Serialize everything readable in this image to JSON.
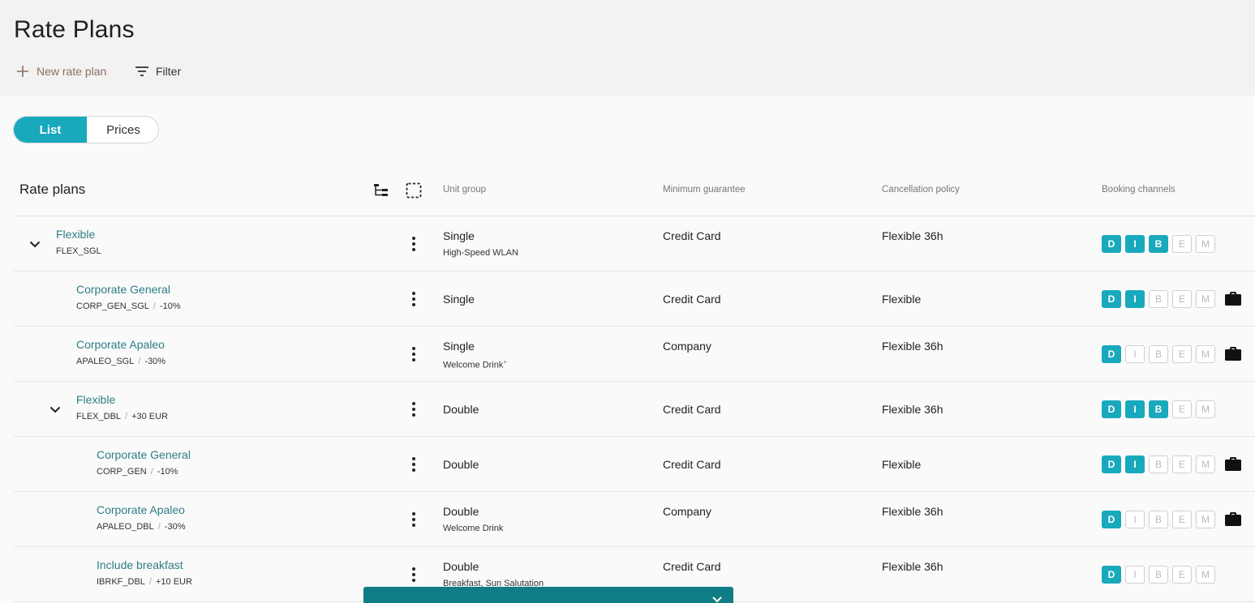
{
  "page": {
    "title": "Rate Plans"
  },
  "actions": {
    "new_label": "New rate plan",
    "filter_label": "Filter"
  },
  "view_toggle": {
    "list": "List",
    "prices": "Prices",
    "selected": "List"
  },
  "table": {
    "title": "Rate plans",
    "columns": {
      "unit_group": "Unit group",
      "minimum_guarantee": "Minimum guarantee",
      "cancellation_policy": "Cancellation policy",
      "booking_channels": "Booking channels"
    },
    "channel_letters": [
      "D",
      "I",
      "B",
      "E",
      "M"
    ],
    "rows": [
      {
        "name": "Flexible",
        "code": "FLEX_SGL",
        "modifier": "",
        "level": 0,
        "expandable": true,
        "unit_group": "Single",
        "unit_extra": "High-Speed WLAN",
        "unit_extra_sup": "",
        "guarantee": "Credit Card",
        "cancellation": "Flexible 36h",
        "channels": [
          true,
          true,
          true,
          false,
          false
        ],
        "corporate": false
      },
      {
        "name": "Corporate General",
        "code": "CORP_GEN_SGL",
        "modifier": "-10%",
        "level": 1,
        "expandable": false,
        "unit_group": "Single",
        "unit_extra": "",
        "unit_extra_sup": "",
        "guarantee": "Credit Card",
        "cancellation": "Flexible",
        "channels": [
          true,
          true,
          false,
          false,
          false
        ],
        "corporate": true
      },
      {
        "name": "Corporate Apaleo",
        "code": "APALEO_SGL",
        "modifier": "-30%",
        "level": 1,
        "expandable": false,
        "unit_group": "Single",
        "unit_extra": "Welcome Drink",
        "unit_extra_sup": "+",
        "guarantee": "Company",
        "cancellation": "Flexible 36h",
        "channels": [
          true,
          false,
          false,
          false,
          false
        ],
        "corporate": true
      },
      {
        "name": "Flexible",
        "code": "FLEX_DBL",
        "modifier": "+30 EUR",
        "level": 1,
        "expandable": true,
        "unit_group": "Double",
        "unit_extra": "",
        "unit_extra_sup": "",
        "guarantee": "Credit Card",
        "cancellation": "Flexible 36h",
        "channels": [
          true,
          true,
          true,
          false,
          false
        ],
        "corporate": false
      },
      {
        "name": "Corporate General",
        "code": "CORP_GEN",
        "modifier": "-10%",
        "level": 2,
        "expandable": false,
        "unit_group": "Double",
        "unit_extra": "",
        "unit_extra_sup": "",
        "guarantee": "Credit Card",
        "cancellation": "Flexible",
        "channels": [
          true,
          true,
          false,
          false,
          false
        ],
        "corporate": true
      },
      {
        "name": "Corporate Apaleo",
        "code": "APALEO_DBL",
        "modifier": "-30%",
        "level": 2,
        "expandable": false,
        "unit_group": "Double",
        "unit_extra": "Welcome Drink",
        "unit_extra_sup": "",
        "guarantee": "Company",
        "cancellation": "Flexible 36h",
        "channels": [
          true,
          false,
          false,
          false,
          false
        ],
        "corporate": true
      },
      {
        "name": "Include breakfast",
        "code": "IBRKF_DBL",
        "modifier": "+10 EUR",
        "level": 2,
        "expandable": false,
        "unit_group": "Double",
        "unit_extra": "Breakfast, Sun Salutation",
        "unit_extra_sup": "",
        "guarantee": "Credit Card",
        "cancellation": "Flexible 36h",
        "channels": [
          true,
          false,
          false,
          false,
          false
        ],
        "corporate": false
      }
    ]
  },
  "icons": {
    "new": "plus-icon",
    "filter": "filter-icon",
    "tree": "tree-view-icon",
    "select": "select-dashed-icon",
    "expand": "chevron-down-icon",
    "menu": "more-vert-icon",
    "corporate": "briefcase-icon",
    "close": "close-icon"
  },
  "colors": {
    "accent": "#18a9bc",
    "link": "#2f7d86",
    "new_action": "#8d6e63",
    "toast": "#0f7d86"
  }
}
